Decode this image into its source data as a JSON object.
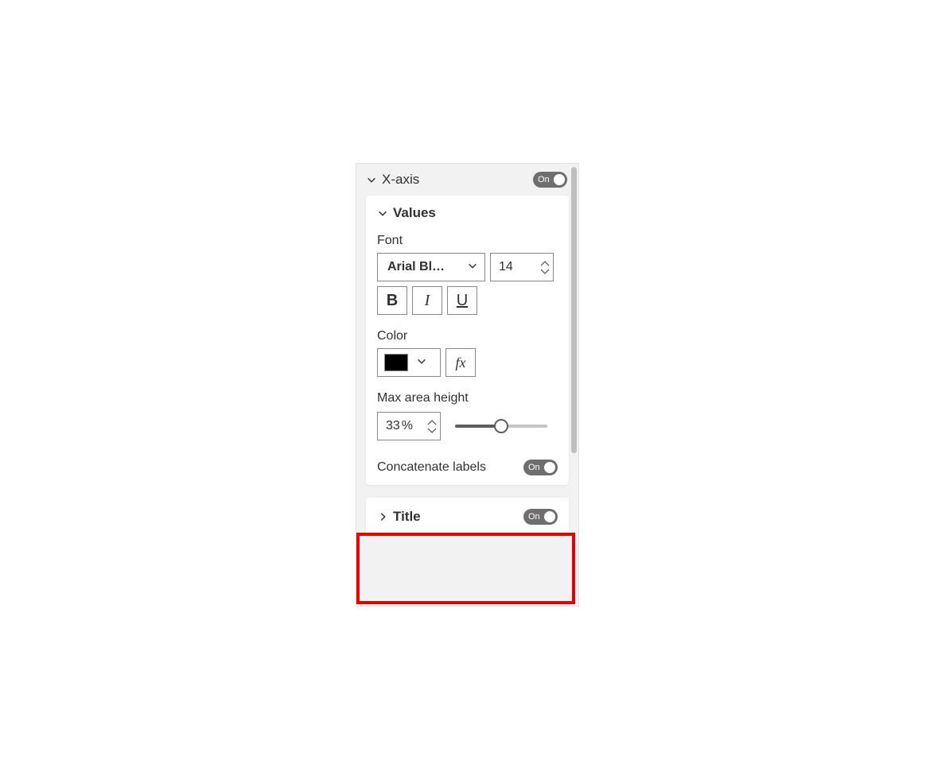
{
  "xaxis": {
    "label": "X-axis",
    "toggle": "On",
    "values": {
      "label": "Values",
      "font": {
        "label": "Font",
        "family": "Arial Bl…",
        "size": "14"
      },
      "styles": {
        "bold": "B",
        "italic": "I",
        "underline": "U"
      },
      "color": {
        "label": "Color",
        "value": "#000000",
        "fx": "fx"
      },
      "maxAreaHeight": {
        "label": "Max area height",
        "value": "33",
        "unit": "%",
        "percent": 50
      },
      "concatenate": {
        "label": "Concatenate labels",
        "toggle": "On"
      }
    },
    "title": {
      "label": "Title",
      "toggle": "On"
    }
  }
}
